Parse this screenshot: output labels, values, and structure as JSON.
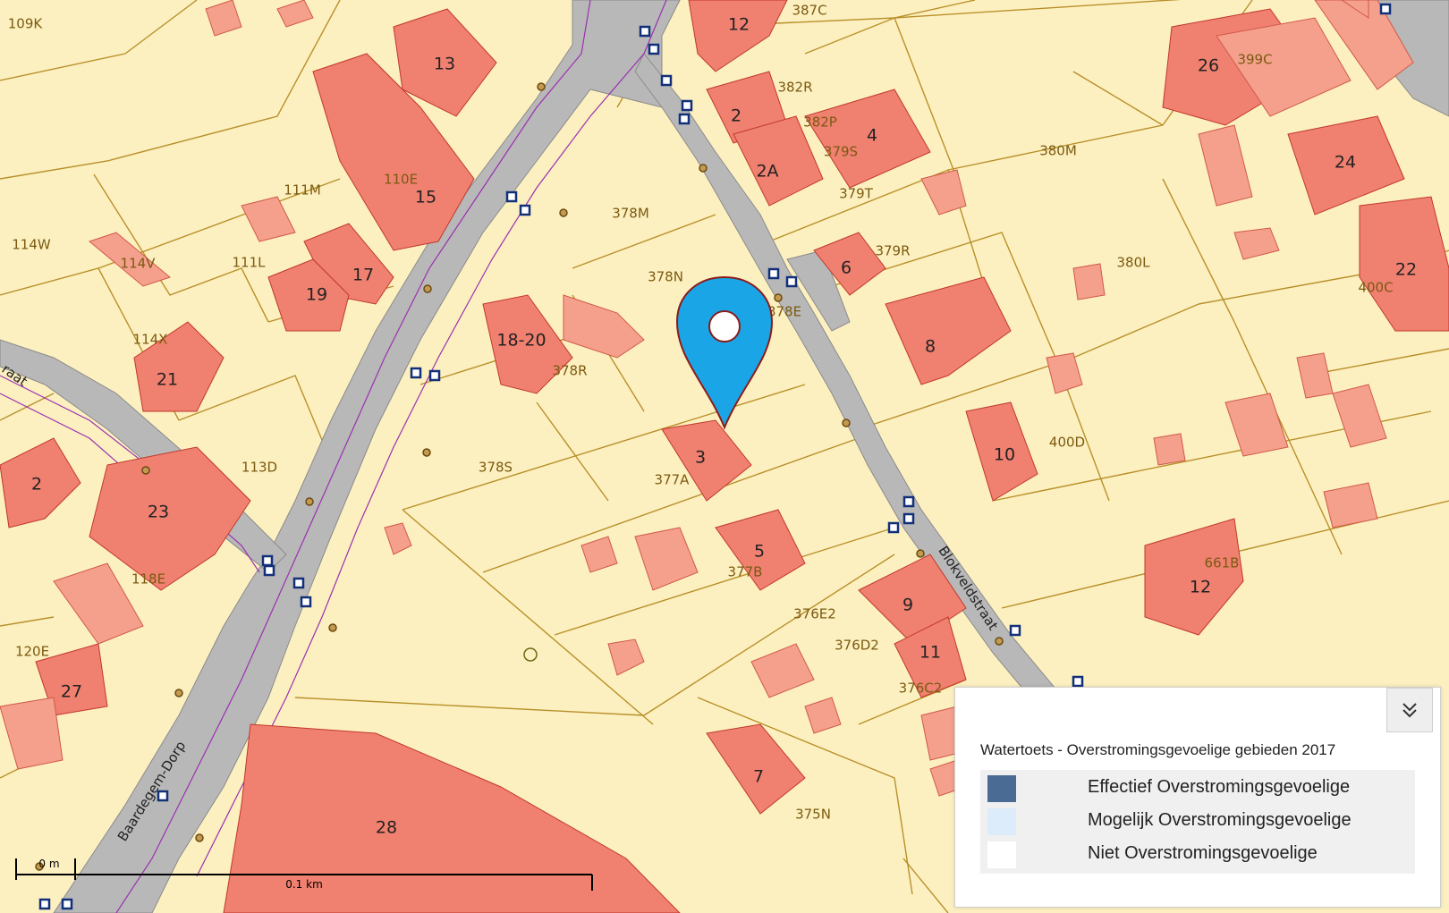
{
  "map": {
    "streets": [
      "Baardegem-Dorp",
      "Blokveldstraat",
      "raat"
    ],
    "building_numbers": [
      "13",
      "12",
      "2",
      "4",
      "2A",
      "26",
      "24",
      "22",
      "15",
      "17",
      "19",
      "6",
      "8",
      "18-20",
      "21",
      "3",
      "10",
      "2",
      "23",
      "5",
      "12",
      "9",
      "11",
      "27",
      "7",
      "28"
    ],
    "parcel_labels": [
      "109K",
      "387C",
      "399C",
      "382R",
      "382P",
      "379S",
      "380M",
      "110E",
      "111M",
      "379T",
      "378M",
      "114W",
      "114V",
      "111L",
      "379R",
      "380L",
      "378N",
      "400C",
      "378E",
      "114X",
      "378R",
      "400D",
      "113D",
      "378S",
      "377A",
      "118E",
      "377B",
      "661B",
      "376E2",
      "120E",
      "376D2",
      "376C2",
      "375N"
    ],
    "marker": "location-pin",
    "colors": {
      "background": "#fdf0c0",
      "building": "#f08070",
      "road": "#b8b8b8",
      "marker": "#1aa6e6"
    }
  },
  "scale": {
    "label_start": "0 m",
    "label_end": "0.1 km"
  },
  "legend": {
    "title": "Watertoets - Overstromingsgevoelige gebieden 2017",
    "items": [
      {
        "label": "Effectief Overstromingsgevoelige",
        "color": "#4a6b94"
      },
      {
        "label": "Mogelijk Overstromingsgevoelige",
        "color": "#dcecfb"
      },
      {
        "label": "Niet Overstromingsgevoelige",
        "color": "#ffffff"
      }
    ]
  }
}
